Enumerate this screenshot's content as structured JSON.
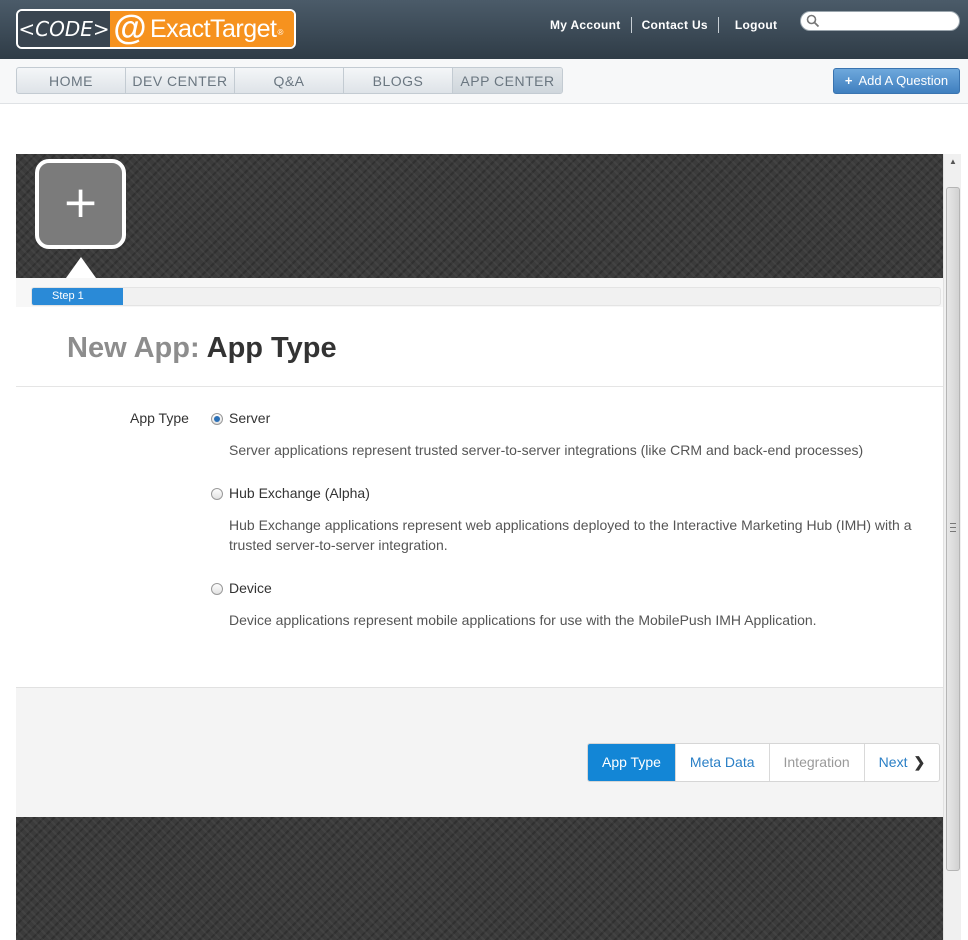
{
  "header": {
    "logo": {
      "code": "<CODE>",
      "at": "@",
      "brand": "ExactTarget",
      "reg": "®"
    },
    "links": {
      "account": "My Account",
      "contact": "Contact Us",
      "logout": "Logout"
    },
    "search": {
      "placeholder": "",
      "icon": "search-icon"
    }
  },
  "nav": {
    "tabs": [
      {
        "label": "HOME"
      },
      {
        "label": "DEV CENTER"
      },
      {
        "label": "Q&A"
      },
      {
        "label": "BLOGS"
      },
      {
        "label": "APP CENTER"
      }
    ],
    "active_tab": "APP CENTER",
    "add_question": {
      "icon": "+",
      "label": "Add A Question"
    }
  },
  "app_icon": {
    "glyph": "+"
  },
  "progress": {
    "label": "Step 1",
    "fraction": 0.1
  },
  "page": {
    "title_prefix": "New App:",
    "title_main": "App Type"
  },
  "form": {
    "field_label": "App Type",
    "options": [
      {
        "name": "Server",
        "checked": true,
        "description": "Server applications represent trusted server-to-server integrations (like CRM and back-end processes)"
      },
      {
        "name": "Hub Exchange (Alpha)",
        "checked": false,
        "description": "Hub Exchange applications represent web applications deployed to the Interactive Marketing Hub (IMH) with a trusted server-to-server integration."
      },
      {
        "name": "Device",
        "checked": false,
        "description": "Device applications represent mobile applications for use with the MobilePush IMH Application."
      }
    ]
  },
  "steps": {
    "items": [
      {
        "label": "App Type",
        "state": "active"
      },
      {
        "label": "Meta Data",
        "state": "link"
      },
      {
        "label": "Integration",
        "state": "disabled"
      }
    ],
    "next_label": "Next",
    "next_icon": "chevron-right-icon"
  },
  "colors": {
    "brand_orange": "#f6921e",
    "accent_blue": "#1386d6",
    "header_dark": "#3a4752"
  }
}
